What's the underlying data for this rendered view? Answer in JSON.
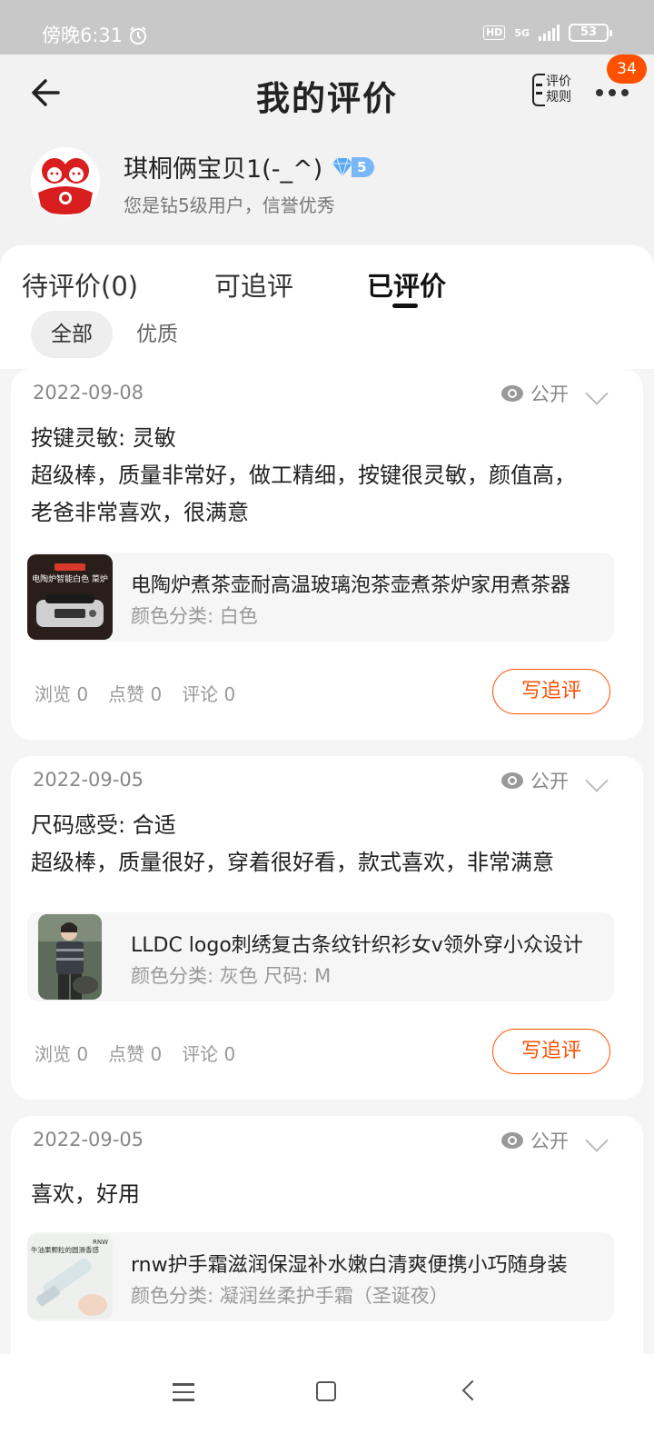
{
  "status_bar": {
    "time": "傍晚6:31",
    "hd": "HD",
    "network": "5G",
    "battery": "53"
  },
  "header": {
    "title": "我的评价",
    "rules_label": "评价规则",
    "more_badge": "34",
    "back_icon": "arrow-left-icon",
    "more_icon": "more-dots-icon"
  },
  "profile": {
    "username": "琪桐俩宝贝1(-_^)",
    "level": "5",
    "subtitle": "您是钻5级用户，信誉优秀"
  },
  "tabs": [
    {
      "label": "待评价(0)"
    },
    {
      "label": "可追评"
    },
    {
      "label": "已评价"
    }
  ],
  "filters": [
    {
      "label": "全部"
    },
    {
      "label": "优质"
    }
  ],
  "reviews": [
    {
      "date": "2022-09-08",
      "visibility": "公开",
      "lines": [
        "按键灵敏: 灵敏",
        "超级棒，质量非常好，做工精细，按键很灵敏，颜值高，",
        "老爸非常喜欢，很满意"
      ],
      "product_title": "电陶炉煮茶壶耐高温玻璃泡茶壶煮茶炉家用煮茶器",
      "product_spec": "颜色分类: 白色",
      "thumb_caption": "电陶炉智能白色 菜炉",
      "views": "浏览 0",
      "likes": "点赞 0",
      "comments": "评论 0",
      "follow_label": "写追评"
    },
    {
      "date": "2022-09-05",
      "visibility": "公开",
      "lines": [
        "尺码感受: 合适",
        "超级棒，质量很好，穿着很好看，款式喜欢，非常满意"
      ],
      "product_title": "LLDC logo刺绣复古条纹针织衫女v领外穿小众设计",
      "product_spec": "颜色分类: 灰色 尺码: M",
      "views": "浏览 0",
      "likes": "点赞 0",
      "comments": "评论 0",
      "follow_label": "写追评"
    },
    {
      "date": "2022-09-05",
      "visibility": "公开",
      "lines": [
        "喜欢，好用"
      ],
      "product_title": "rnw护手霜滋润保湿补水嫩白清爽便携小巧随身装",
      "product_spec": "颜色分类: 凝润丝柔护手霜（圣诞夜）",
      "thumb_caption": "牛油果颗粒的圆滑香感",
      "thumb_brand": "RNW"
    }
  ],
  "colors": {
    "accent": "#ff5000",
    "badge": "#ff5000",
    "diamond": "#79b8f8"
  }
}
